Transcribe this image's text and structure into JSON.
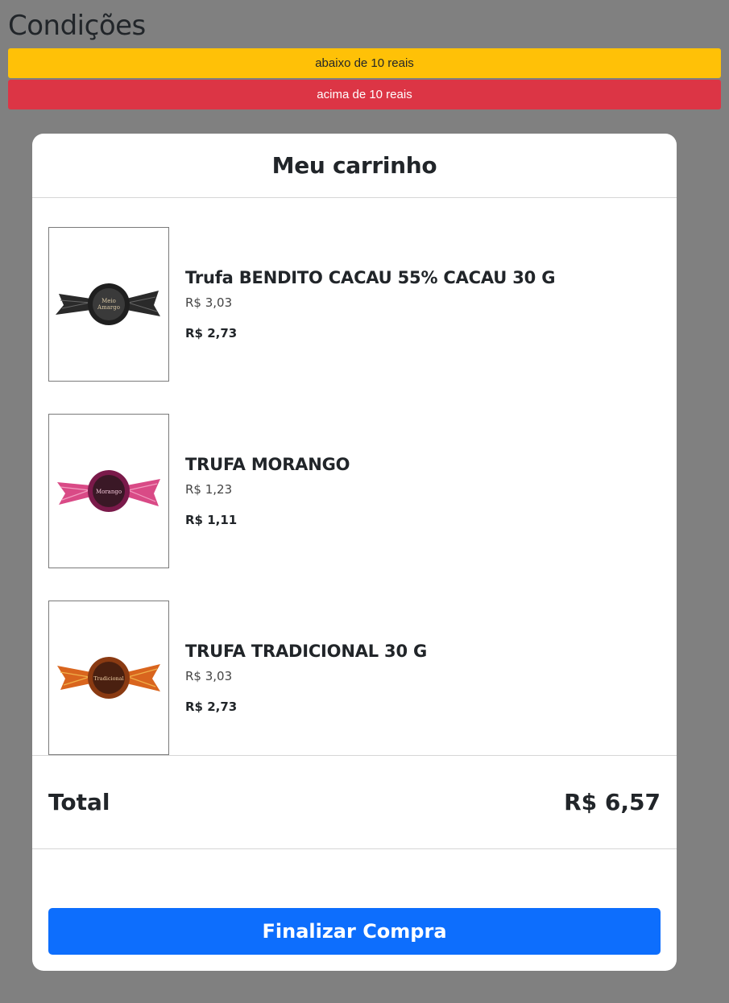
{
  "page": {
    "title": "Condições"
  },
  "conditions": [
    {
      "label": "abaixo de 10 reais",
      "color": "#ffc107"
    },
    {
      "label": "acima de 10 reais",
      "color": "#dc3545"
    }
  ],
  "cart": {
    "title": "Meu carrinho",
    "items": [
      {
        "name": "Trufa BENDITO CACAU 55% CACAU 30 G",
        "price": "R$ 3,03",
        "selling_price": "R$ 2,73",
        "image": "dark-truffle-wrapper"
      },
      {
        "name": "TRUFA MORANGO",
        "price": "R$ 1,23",
        "selling_price": "R$ 1,11",
        "image": "pink-truffle-wrapper"
      },
      {
        "name": "TRUFA TRADICIONAL 30 G",
        "price": "R$ 3,03",
        "selling_price": "R$ 2,73",
        "image": "orange-truffle-wrapper"
      }
    ],
    "total_label": "Total",
    "total_value": "R$ 6,57",
    "checkout_label": "Finalizar Compra"
  },
  "colors": {
    "background": "#808080",
    "accent": "#0d6efd",
    "warning": "#ffc107",
    "danger": "#dc3545"
  }
}
